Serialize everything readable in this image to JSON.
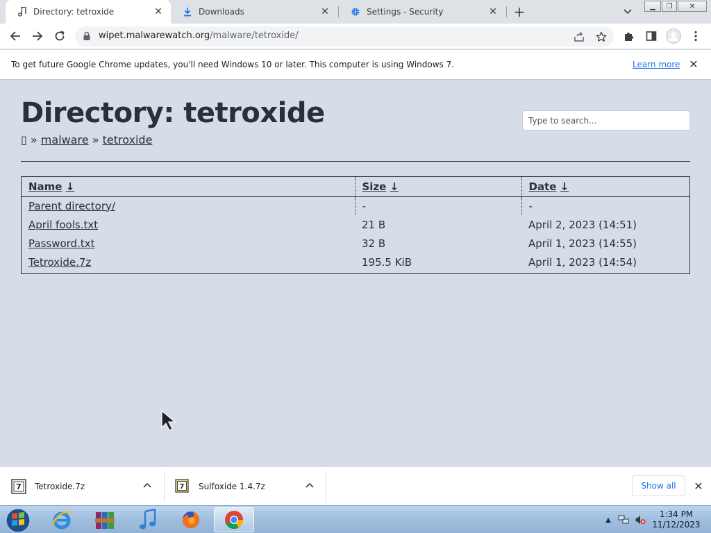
{
  "tabs": [
    {
      "title": "Directory: tetroxide",
      "icon": "music-note-icon",
      "active": true
    },
    {
      "title": "Downloads",
      "icon": "download-icon",
      "active": false
    },
    {
      "title": "Settings - Security",
      "icon": "gear-icon",
      "active": false
    }
  ],
  "toolbar": {
    "url_host": "wipet.malwarewatch.org",
    "url_path": "/malware/tetroxide/"
  },
  "infobar": {
    "message": "To get future Google Chrome updates, you'll need Windows 10 or later. This computer is using Windows 7.",
    "link": "Learn more"
  },
  "page": {
    "heading": "Directory: tetroxide",
    "breadcrumb": {
      "home_glyph": "▯",
      "sep": "»",
      "items": [
        "malware",
        "tetroxide"
      ]
    },
    "search_placeholder": "Type to search...",
    "columns": [
      {
        "label": "Name",
        "sort": "↓"
      },
      {
        "label": "Size",
        "sort": "↓"
      },
      {
        "label": "Date",
        "sort": "↓"
      }
    ],
    "rows": [
      {
        "name": "Parent directory/",
        "size": "-",
        "date": "-"
      },
      {
        "name": "April fools.txt",
        "size": "21 B",
        "date": "April 2, 2023 (14:51)"
      },
      {
        "name": "Password.txt",
        "size": "32 B",
        "date": "April 1, 2023 (14:55)"
      },
      {
        "name": "Tetroxide.7z",
        "size": "195.5 KiB",
        "date": "April 1, 2023 (14:54)"
      }
    ]
  },
  "downloads": {
    "items": [
      {
        "name": "Tetroxide.7z",
        "icon": "7z-archive-icon"
      },
      {
        "name": "Sulfoxide 1.4.7z",
        "icon": "7z-archive-icon"
      }
    ],
    "show_all": "Show all"
  },
  "taskbar": {
    "apps": [
      "internet-explorer",
      "winrar",
      "itunes",
      "firefox",
      "chrome"
    ],
    "active_app": "chrome",
    "time": "1:34 PM",
    "date": "11/12/2023"
  },
  "colors": {
    "page_bg": "#d6dce8",
    "text": "#2a2f3a",
    "link_blue": "#1a73e8",
    "tabstrip_bg": "#dee1e6"
  }
}
